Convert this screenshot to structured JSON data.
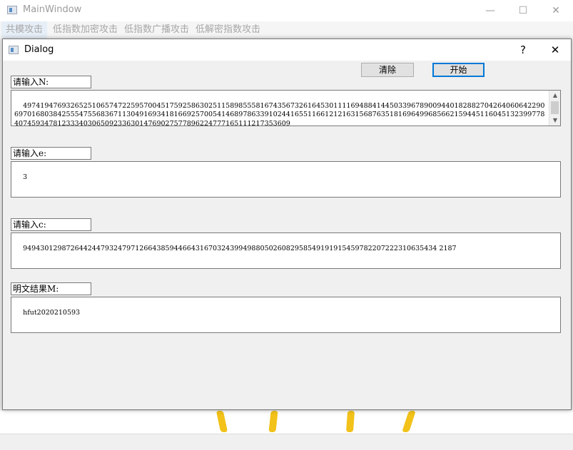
{
  "main_window": {
    "title": "MainWindow",
    "controls": {
      "minimize": "—",
      "maximize": "☐",
      "close": "✕"
    },
    "menu": [
      {
        "label": "共模攻击"
      },
      {
        "label": "低指数加密攻击"
      },
      {
        "label": "低指数广播攻击"
      },
      {
        "label": "低解密指数攻击"
      }
    ]
  },
  "dialog": {
    "title": "Dialog",
    "help_button": "?",
    "close_button": "✕",
    "clear_button": "清除",
    "start_button": "开始",
    "fields": {
      "n": {
        "label": "请输入N:",
        "value": "49741947693265251065747225957004517592586302511589855581674356732616453011116948841445033967890094401828827042640606422906970168038425554755683671130491693418166925700541468978633910244165511661212163156876351816964996856621594451160451323997784074593478123334030650923363014769027577896224777165111217353609"
      },
      "e": {
        "label": "请输入e:",
        "value": "3"
      },
      "c": {
        "label": "请输入c:",
        "value": "949430129872644244793247971266438594466431670324399498805026082958549191915459782207222310635434 2187"
      },
      "m": {
        "label": "明文结果M:",
        "value": "hfut2020210593"
      }
    }
  },
  "colors": {
    "accent": "#0078d7",
    "decor_yellow": "#f2c21a",
    "disabled_text": "#9b9b9b"
  }
}
